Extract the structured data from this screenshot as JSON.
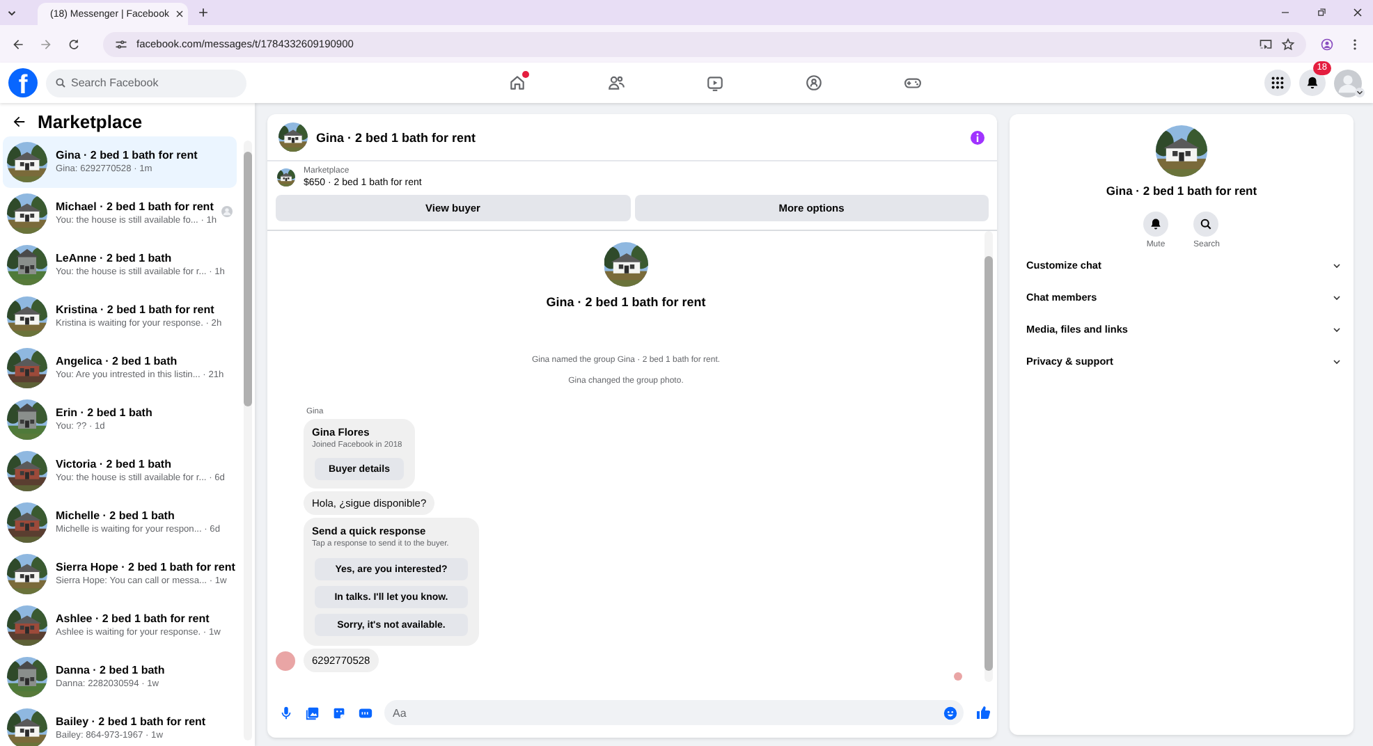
{
  "browser": {
    "tab_title": "(18) Messenger | Facebook",
    "url": "facebook.com/messages/t/1784332609190900"
  },
  "header": {
    "logo_text": "f",
    "search_placeholder": "Search Facebook",
    "nav": [
      {
        "kind": "home",
        "notification": true
      },
      {
        "kind": "friends",
        "notification": false
      },
      {
        "kind": "video",
        "notification": false
      },
      {
        "kind": "groups",
        "notification": false
      },
      {
        "kind": "gaming",
        "notification": false
      }
    ],
    "notification_count": "18"
  },
  "sidebar": {
    "title": "Marketplace",
    "chats": [
      {
        "title": "Gina · 2 bed 1 bath for rent",
        "preview": "Gina: 6292770528 · 1m",
        "selected": true,
        "seen_avatar": false
      },
      {
        "title": "Michael · 2 bed 1 bath for rent",
        "preview": "You: the house is still available fo... · 1h",
        "selected": false,
        "seen_avatar": true
      },
      {
        "title": "LeAnne · 2 bed 1 bath",
        "preview": "You: the house is still available for r... · 1h",
        "selected": false,
        "seen_avatar": false
      },
      {
        "title": "Kristina · 2 bed 1 bath for rent",
        "preview": "Kristina is waiting for your response. · 2h",
        "selected": false,
        "seen_avatar": false
      },
      {
        "title": "Angelica · 2 bed 1 bath",
        "preview": "You: Are you intrested in this listin... · 21h",
        "selected": false,
        "seen_avatar": false
      },
      {
        "title": "Erin · 2 bed 1 bath",
        "preview": "You: ?? · 1d",
        "selected": false,
        "seen_avatar": false
      },
      {
        "title": "Victoria · 2 bed 1 bath",
        "preview": "You: the house is still available for r... · 6d",
        "selected": false,
        "seen_avatar": false
      },
      {
        "title": "Michelle · 2 bed 1 bath",
        "preview": "Michelle is waiting for your respon... · 6d",
        "selected": false,
        "seen_avatar": false
      },
      {
        "title": "Sierra Hope · 2 bed 1 bath for rent",
        "preview": "Sierra Hope: You can call or messa... · 1w",
        "selected": false,
        "seen_avatar": false
      },
      {
        "title": "Ashlee · 2 bed 1 bath for rent",
        "preview": "Ashlee is waiting for your response. · 1w",
        "selected": false,
        "seen_avatar": false
      },
      {
        "title": "Danna · 2 bed 1 bath",
        "preview": "Danna: 2282030594 · 1w",
        "selected": false,
        "seen_avatar": false
      },
      {
        "title": "Bailey · 2 bed 1 bath for rent",
        "preview": "Bailey: 864-973-1967 · 1w",
        "selected": false,
        "seen_avatar": false
      }
    ]
  },
  "conversation": {
    "title": "Gina · 2 bed 1 bath for rent",
    "listing": {
      "label": "Marketplace",
      "price_line": "$650 · 2 bed 1 bath for rent"
    },
    "actions": [
      "View buyer",
      "More options"
    ],
    "intro_title": "Gina · 2 bed 1 bath for rent",
    "events": [
      "Gina named the group Gina · 2 bed 1 bath for rent.",
      "Gina changed the group photo."
    ],
    "messages": [
      {
        "kind": "sender_label",
        "text": "Gina"
      },
      {
        "kind": "buyer_card",
        "name": "Gina Flores",
        "subtitle": "Joined Facebook in 2018",
        "button": "Buyer details"
      },
      {
        "kind": "text",
        "text": "Hola, ¿sigue disponible?",
        "show_avatar": false
      },
      {
        "kind": "quick_replies",
        "title": "Send a quick response",
        "subtitle": "Tap a response to send it to the buyer.",
        "options": [
          "Yes, are you interested?",
          "In talks. I'll let you know.",
          "Sorry, it's not available."
        ]
      },
      {
        "kind": "text",
        "text": "6292770528",
        "show_avatar": true
      }
    ],
    "read_receipt": true,
    "composer": {
      "placeholder": "Aa"
    }
  },
  "details": {
    "title": "Gina · 2 bed 1 bath for rent",
    "actions": [
      {
        "kind": "mute",
        "label": "Mute"
      },
      {
        "kind": "search",
        "label": "Search"
      }
    ],
    "sections": [
      {
        "label": "Customize chat",
        "expanded": false
      },
      {
        "label": "Chat members",
        "expanded": false
      },
      {
        "label": "Media, files and links",
        "expanded": false
      },
      {
        "label": "Privacy & support",
        "expanded": false
      }
    ]
  }
}
